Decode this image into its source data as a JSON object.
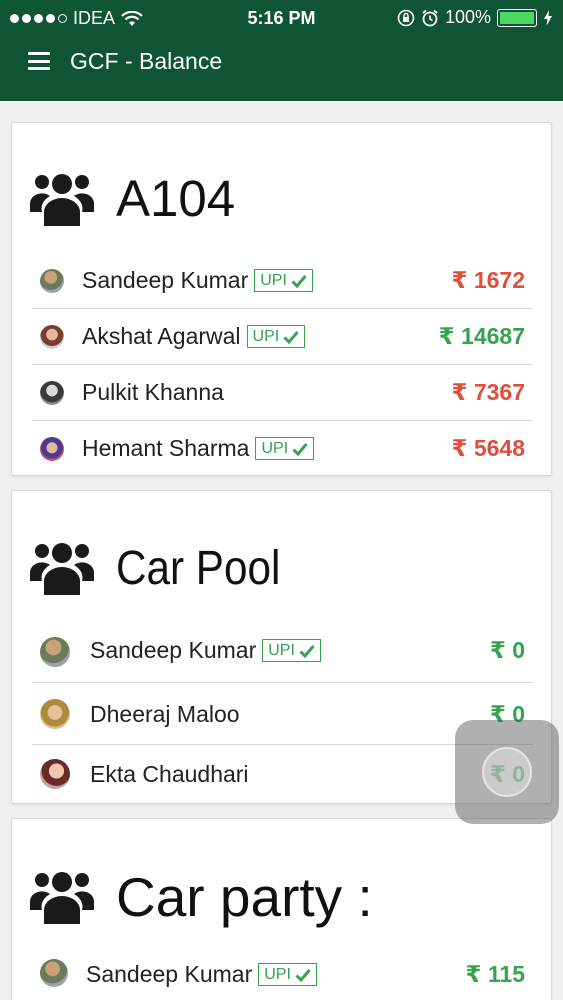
{
  "status_bar": {
    "carrier": "IDEA",
    "time": "5:16 PM",
    "battery": "100%",
    "battery_level": 1.0,
    "battery_color": "#4cd964"
  },
  "app_bar": {
    "title": "GCF - Balance",
    "background": "#0f5535",
    "menu_icon": "hamburger-menu-icon"
  },
  "colors": {
    "negative": "#e04f3e",
    "positive": "#35a350"
  },
  "groups": [
    {
      "name": "A104",
      "icon": "group-people-icon",
      "members": [
        {
          "name": "Sandeep Kumar",
          "upi": true,
          "upi_label": "UPI",
          "amount": "₹ 1672",
          "status": "negative"
        },
        {
          "name": "Akshat Agarwal",
          "upi": true,
          "upi_label": "UPI",
          "amount": "₹ 14687",
          "status": "positive"
        },
        {
          "name": "Pulkit Khanna",
          "upi": false,
          "amount": "₹ 7367",
          "status": "negative"
        },
        {
          "name": "Hemant Sharma",
          "upi": true,
          "upi_label": "UPI",
          "amount": "₹ 5648",
          "status": "negative"
        }
      ]
    },
    {
      "name": "Car Pool",
      "icon": "group-people-icon",
      "members": [
        {
          "name": "Sandeep Kumar",
          "upi": true,
          "upi_label": "UPI",
          "amount": "₹ 0",
          "status": "positive"
        },
        {
          "name": "Dheeraj Maloo",
          "upi": false,
          "amount": "₹ 0",
          "status": "positive"
        },
        {
          "name": "Ekta Chaudhari",
          "upi": false,
          "amount": "₹ 0",
          "status": "positive"
        }
      ]
    },
    {
      "name": "Car party :",
      "icon": "group-people-icon",
      "members": [
        {
          "name": "Sandeep Kumar",
          "upi": true,
          "upi_label": "UPI",
          "amount": "₹ 115",
          "status": "positive"
        }
      ]
    }
  ]
}
